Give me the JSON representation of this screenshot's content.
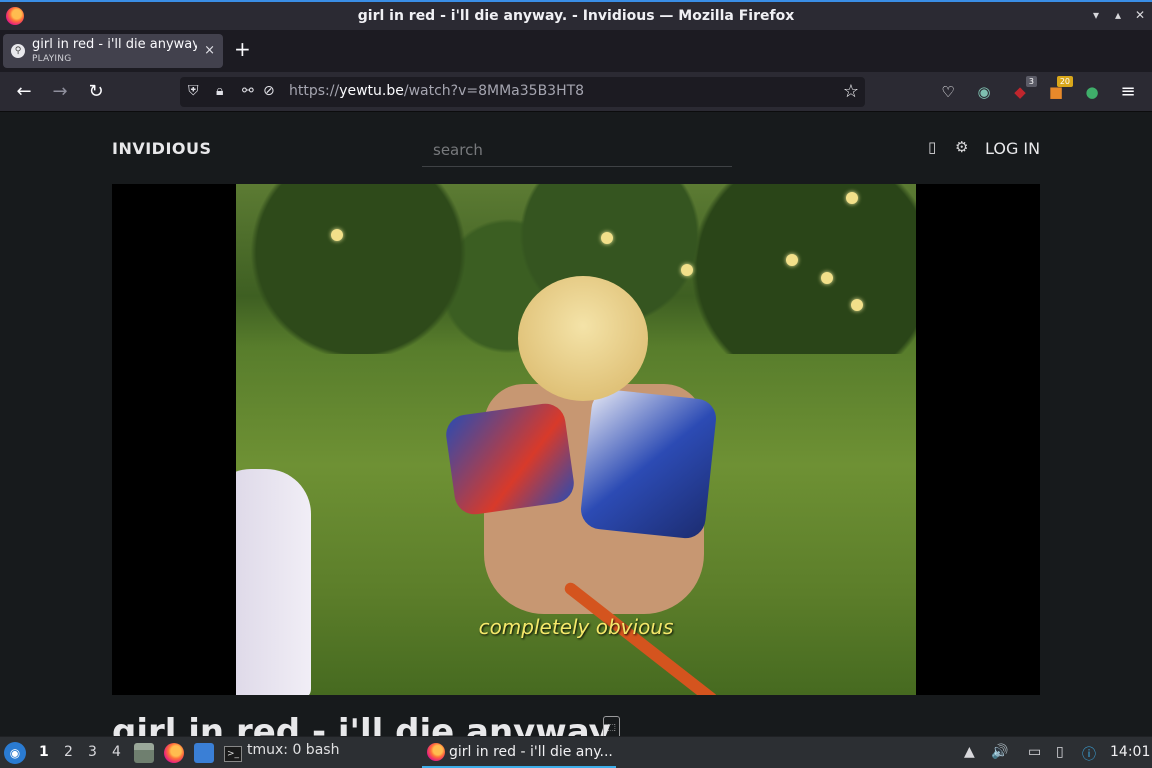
{
  "window": {
    "title": "girl in red - i'll die anyway. - Invidious — Mozilla Firefox",
    "controls": [
      "▾",
      "▴",
      "⤢",
      "✕"
    ]
  },
  "tab": {
    "label": "girl in red - i'll die anyway",
    "status": "PLAYING",
    "close": "×",
    "new_tab": "+"
  },
  "nav": {
    "back": "←",
    "forward": "→",
    "reload": "↻",
    "url_prefix": "https://",
    "url_host": "yewtu.be",
    "url_path": "/watch?v=8MMa35B3HT8",
    "bookmark_icon": "☆",
    "extensions": [
      {
        "name": "pocket-icon",
        "glyph": "♡"
      },
      {
        "name": "privacy-extension-icon",
        "glyph": "◉"
      },
      {
        "name": "ublock-icon",
        "glyph": "◆",
        "badge": "3",
        "badge_color": "#5b5b66"
      },
      {
        "name": "extension-orange-icon",
        "glyph": "■",
        "badge": "20",
        "badge_color": "#d9a71b"
      },
      {
        "name": "sync-extension-icon",
        "glyph": "●"
      }
    ],
    "menu_icon": "≡"
  },
  "invidious": {
    "brand": "INVIDIOUS",
    "search_placeholder": "search",
    "theme_icon": "▯",
    "prefs_icon": "⚙",
    "login": "LOG IN"
  },
  "video": {
    "subtitle": "completely obvious",
    "title": "girl in red - i'll die anyway.",
    "title_icon": "⬚"
  },
  "taskbar": {
    "start_icon": "◉",
    "workspaces": [
      "1",
      "2",
      "3",
      "4"
    ],
    "terminal_label": "tmux: 0 bash",
    "task_label": "girl in red - i'll die any...",
    "clock": "14:01",
    "tray": [
      "▲",
      "🔊",
      "▭",
      "▯",
      "ⓘ"
    ]
  },
  "colors": {
    "accent": "#3daee9",
    "subtitle": "#f4e86a",
    "page_bg": "#171a1c"
  }
}
